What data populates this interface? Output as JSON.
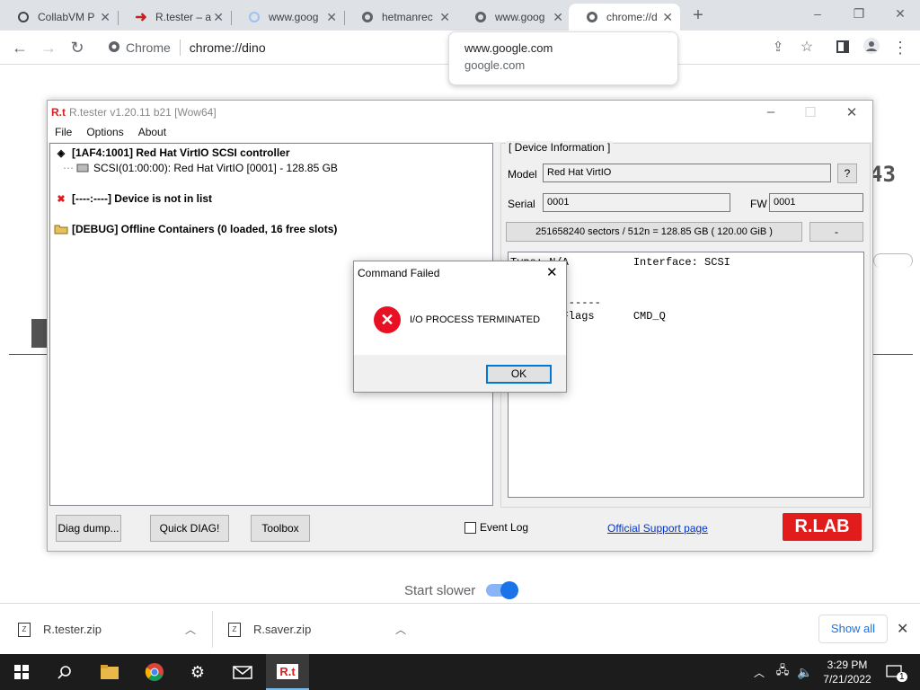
{
  "browser": {
    "tabs": [
      {
        "label": "CollabVM P",
        "icon": "collabvm-icon"
      },
      {
        "label": "R.tester – a",
        "icon": "arrow-icon"
      },
      {
        "label": "www.goog",
        "icon": "loading-icon"
      },
      {
        "label": "hetmanrec",
        "icon": "globe-icon"
      },
      {
        "label": "www.goog",
        "icon": "globe-icon"
      },
      {
        "label": "chrome://d",
        "icon": "globe-icon"
      }
    ],
    "new_tab": "+",
    "omnibox": {
      "chip": "Chrome",
      "url": "chrome://dino"
    },
    "hover_card": {
      "title": "www.google.com",
      "domain": "google.com"
    }
  },
  "dino_page": {
    "score": "43",
    "start_slower": "Start slower"
  },
  "rtester": {
    "title": "R.tester v1.20.11 b21 [Wow64]",
    "logo": "R.t",
    "menu": [
      "File",
      "Options",
      "About"
    ],
    "tree": [
      {
        "label": "[1AF4:1001] Red Hat VirtIO SCSI controller"
      },
      {
        "label": "SCSI(01:00:00):  Red Hat VirtIO [0001]  - 128.85 GB"
      },
      {
        "label": "[----:----] Device is not in list"
      },
      {
        "label": "[DEBUG] Offline Containers (0 loaded, 16 free slots)"
      }
    ],
    "device_info": {
      "legend": "[ Device Information ]",
      "model_label": "Model",
      "model": "Red Hat VirtIO",
      "help": "?",
      "serial_label": "Serial",
      "serial": "0001",
      "fw_label": "FW",
      "fw": "0001",
      "capacity": "251658240 sectors / 512n  =  128.85 GB ( 120.00 GiB )",
      "capacity_btn": "-",
      "console": "Type: N/A          Interface: SCSI\n\n\n--------------\nCommand Flags      CMD_Q"
    },
    "buttons": {
      "diag_dump": "Diag dump...",
      "quick_diag": "Quick DIAG!",
      "toolbox": "Toolbox"
    },
    "event_log": "Event Log",
    "support_link": "Official Support page",
    "rlab": "R.LAB"
  },
  "dialog": {
    "title": "Command Failed",
    "message": "I/O PROCESS TERMINATED",
    "ok": "OK"
  },
  "downloads": {
    "items": [
      {
        "name": "R.tester.zip"
      },
      {
        "name": "R.saver.zip"
      }
    ],
    "show_all": "Show all"
  },
  "taskbar": {
    "time": "3:29 PM",
    "date": "7/21/2022",
    "notifications": "1",
    "active_app": "R.t"
  }
}
